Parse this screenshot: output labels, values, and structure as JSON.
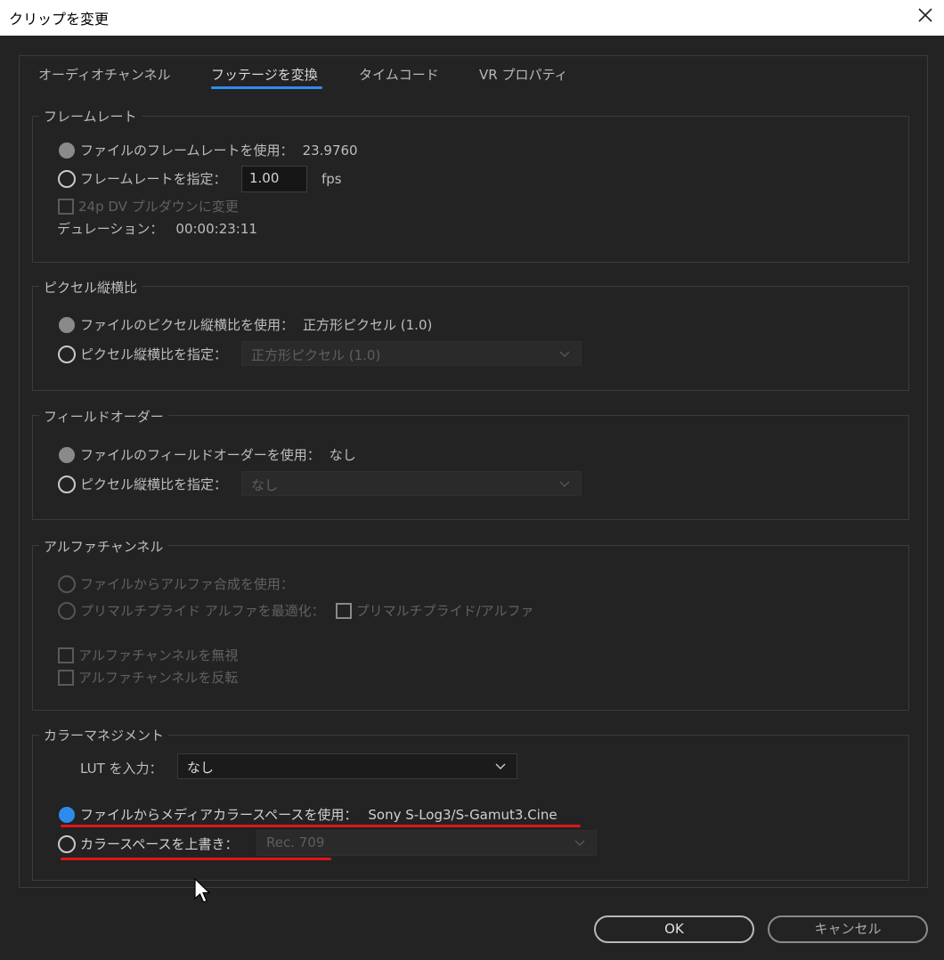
{
  "window": {
    "title": "クリップを変更"
  },
  "tabs": [
    {
      "label": "オーディオチャンネル"
    },
    {
      "label": "フッテージを変換"
    },
    {
      "label": "タイムコード"
    },
    {
      "label": "VR プロパティ"
    }
  ],
  "framerate": {
    "group_label": "フレームレート",
    "use_file_label": "ファイルのフレームレートを使用：",
    "use_file_value": "23.9760",
    "assume_label": "フレームレートを指定：",
    "assume_value": "1.00",
    "fps_unit": "fps",
    "pulldown_label": "24p DV プルダウンに変更",
    "duration_label": "デュレーション：",
    "duration_value": "00:00:23:11"
  },
  "pixel_aspect": {
    "group_label": "ピクセル縦横比",
    "use_file_label": "ファイルのピクセル縦横比を使用：",
    "use_file_value": "正方形ピクセル (1.0)",
    "assume_label": "ピクセル縦横比を指定：",
    "assume_select": "正方形ピクセル (1.0)"
  },
  "field_order": {
    "group_label": "フィールドオーダー",
    "use_file_label": "ファイルのフィールドオーダーを使用：",
    "use_file_value": "なし",
    "assume_label": "ピクセル縦横比を指定：",
    "assume_select": "なし"
  },
  "alpha": {
    "group_label": "アルファチャンネル",
    "use_file_label": "ファイルからアルファ合成を使用：",
    "premult_label": "プリマルチプライド アルファを最適化：",
    "premult_check_label": "プリマルチプライド/アルファ",
    "ignore_label": "アルファチャンネルを無視",
    "invert_label": "アルファチャンネルを反転"
  },
  "color": {
    "group_label": "カラーマネジメント",
    "lut_label": "LUT を入力：",
    "lut_value": "なし",
    "use_media_label": "ファイルからメディアカラースペースを使用：",
    "use_media_value": "Sony S-Log3/S-Gamut3.Cine",
    "override_label": "カラースペースを上書き：",
    "override_select": "Rec. 709",
    "accent": "#2d8ceb",
    "annotation_color": "#e0141b"
  },
  "buttons": {
    "ok": "OK",
    "cancel": "キャンセル"
  }
}
